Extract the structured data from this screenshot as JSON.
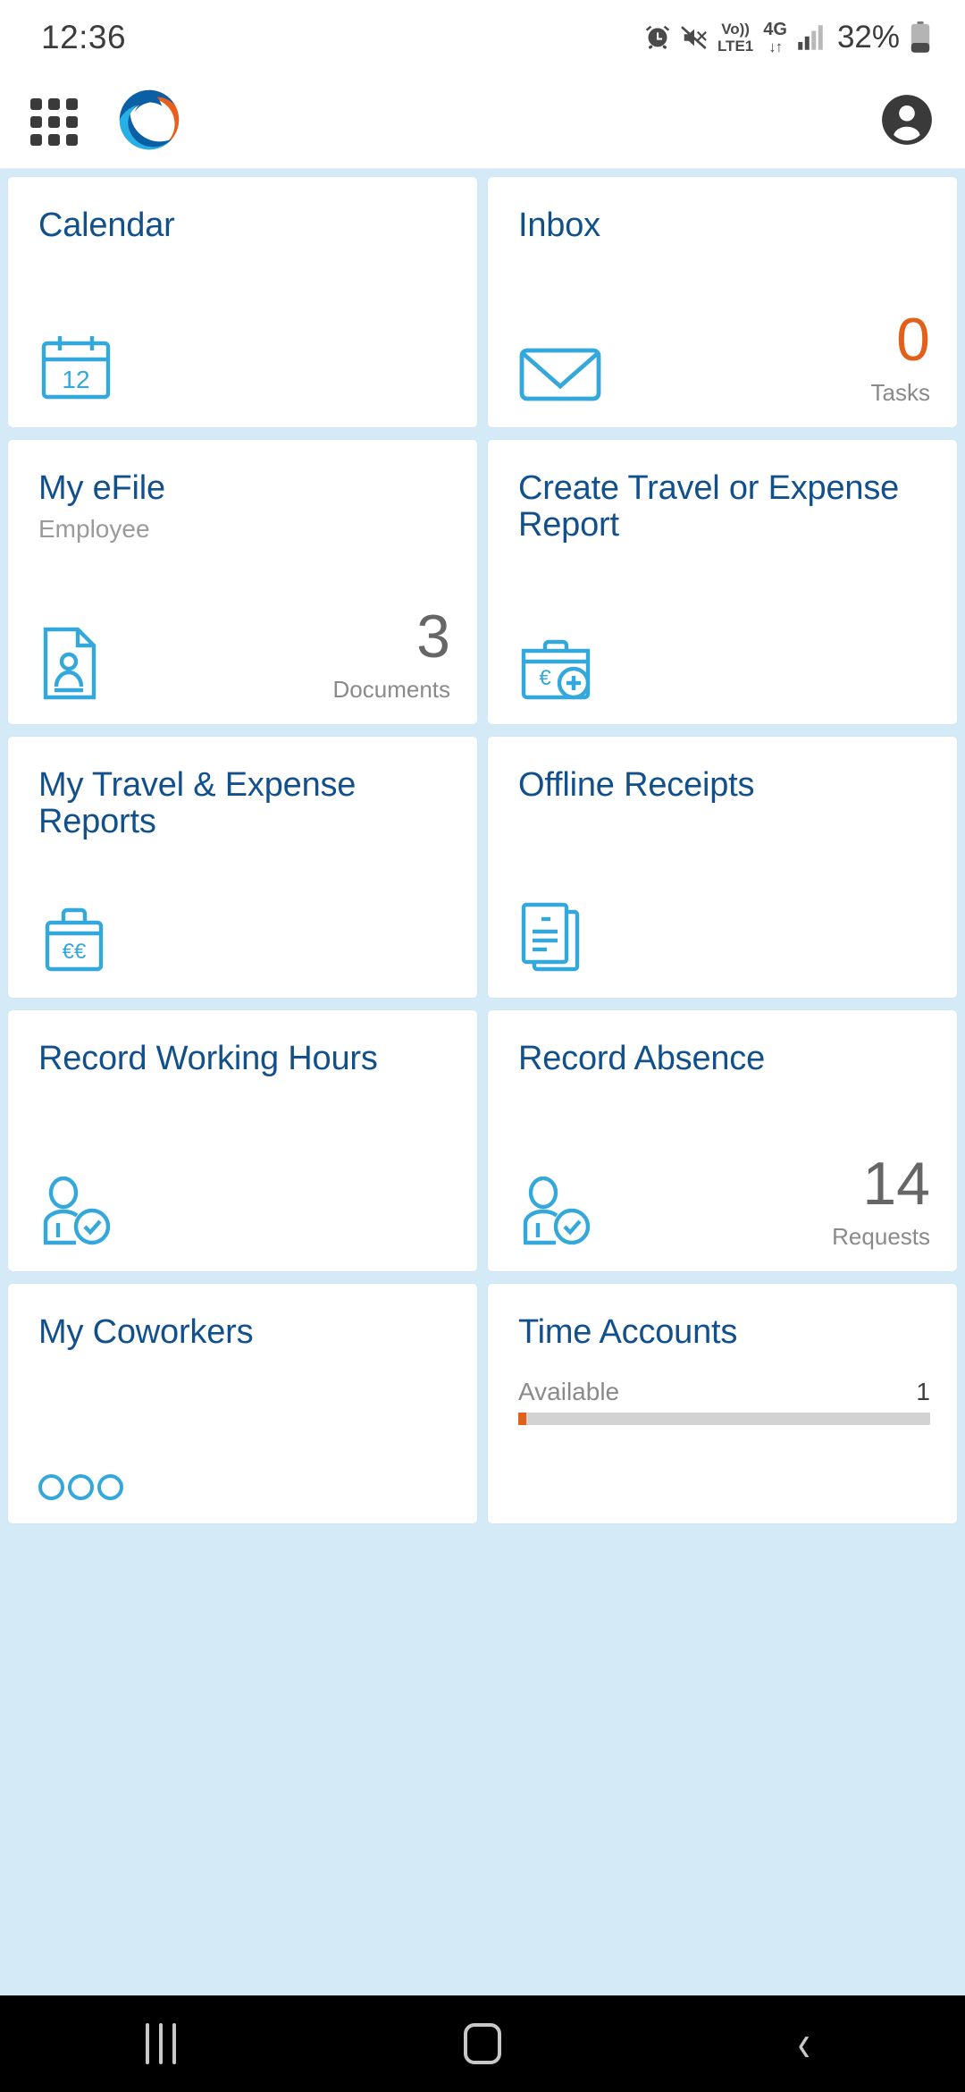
{
  "status_bar": {
    "time": "12:36",
    "volte_line1": "Vo))",
    "volte_line2": "LTE1",
    "network": "4G",
    "network_arrows": "↓↑",
    "battery_percent": "32%",
    "icons": [
      "alarm-icon",
      "mute-icon",
      "volte-icon",
      "network-4g-icon",
      "signal-bars-icon",
      "battery-icon"
    ]
  },
  "app_bar": {
    "menu_icon": "app-grid-icon",
    "logo": "company-logo",
    "profile_icon": "user-avatar-icon"
  },
  "colors": {
    "tile_title": "#12508c",
    "icon_blue": "#34a8db",
    "accent_orange": "#e2601a",
    "kpi_grey": "#666666",
    "page_background": "#d4ebf7",
    "tile_background": "#ffffff"
  },
  "tiles": [
    {
      "title": "Calendar",
      "subtitle": "",
      "icon": "calendar-icon",
      "icon_badge": "12",
      "kpi_value": "",
      "kpi_label": ""
    },
    {
      "title": "Inbox",
      "subtitle": "",
      "icon": "envelope-icon",
      "kpi_value": "0",
      "kpi_label": "Tasks",
      "kpi_accent": true
    },
    {
      "title": "My eFile",
      "subtitle": "Employee",
      "icon": "document-person-icon",
      "kpi_value": "3",
      "kpi_label": "Documents"
    },
    {
      "title": "Create Travel or Expense Report",
      "subtitle": "",
      "icon": "briefcase-euro-plus-icon",
      "kpi_value": "",
      "kpi_label": ""
    },
    {
      "title": "My Travel & Expense Reports",
      "subtitle": "",
      "icon": "briefcase-double-euro-icon",
      "kpi_value": "",
      "kpi_label": ""
    },
    {
      "title": "Offline Receipts",
      "subtitle": "",
      "icon": "stacked-documents-icon",
      "kpi_value": "",
      "kpi_label": ""
    },
    {
      "title": "Record Working Hours",
      "subtitle": "",
      "icon": "person-check-icon",
      "kpi_value": "",
      "kpi_label": ""
    },
    {
      "title": "Record Absence",
      "subtitle": "",
      "icon": "person-check-icon",
      "kpi_value": "14",
      "kpi_label": "Requests"
    },
    {
      "title": "My Coworkers",
      "subtitle": "",
      "icon": "three-circles-icon",
      "kpi_value": "",
      "kpi_label": ""
    },
    {
      "title": "Time Accounts",
      "subtitle": "",
      "account_label": "Available",
      "account_value": "1",
      "progress_percent": 2
    }
  ],
  "nav_bar": {
    "recents_label": "recents-button",
    "home_label": "home-button",
    "back_label": "back-button",
    "back_glyph": "‹"
  }
}
